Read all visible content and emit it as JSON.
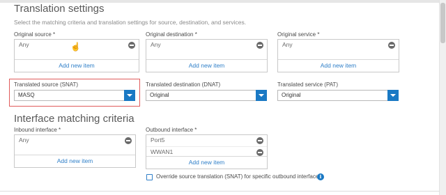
{
  "translation": {
    "title": "Translation settings",
    "description": "Select the matching criteria and translation settings for source, destination, and services.",
    "original_source": {
      "label": "Original source *",
      "items": [
        "Any"
      ],
      "add": "Add new item"
    },
    "original_destination": {
      "label": "Original destination *",
      "items": [
        "Any"
      ],
      "add": "Add new item"
    },
    "original_service": {
      "label": "Original service *",
      "items": [
        "Any"
      ],
      "add": "Add new item"
    },
    "translated_source": {
      "label": "Translated source (SNAT)",
      "value": "MASQ"
    },
    "translated_destination": {
      "label": "Translated destination (DNAT)",
      "value": "Original"
    },
    "translated_service": {
      "label": "Translated service (PAT)",
      "value": "Original"
    }
  },
  "interface": {
    "title": "Interface matching criteria",
    "inbound": {
      "label": "Inbound interface *",
      "items": [
        "Any"
      ],
      "add": "Add new item"
    },
    "outbound": {
      "label": "Outbound interface *",
      "items": [
        "Port5",
        "WWAN1"
      ],
      "add": "Add new item"
    },
    "override_label": "Override source translation (SNAT) for specific outbound interfaces",
    "override_checked": false
  },
  "colors": {
    "accent": "#1a79c4",
    "highlight": "#e05a5a",
    "link": "#2f7fc8"
  },
  "icons": {
    "remove": "minus-circle-icon",
    "dropdown": "chevron-down-icon",
    "info": "info-icon",
    "cursor": "hand-pointer-icon"
  }
}
